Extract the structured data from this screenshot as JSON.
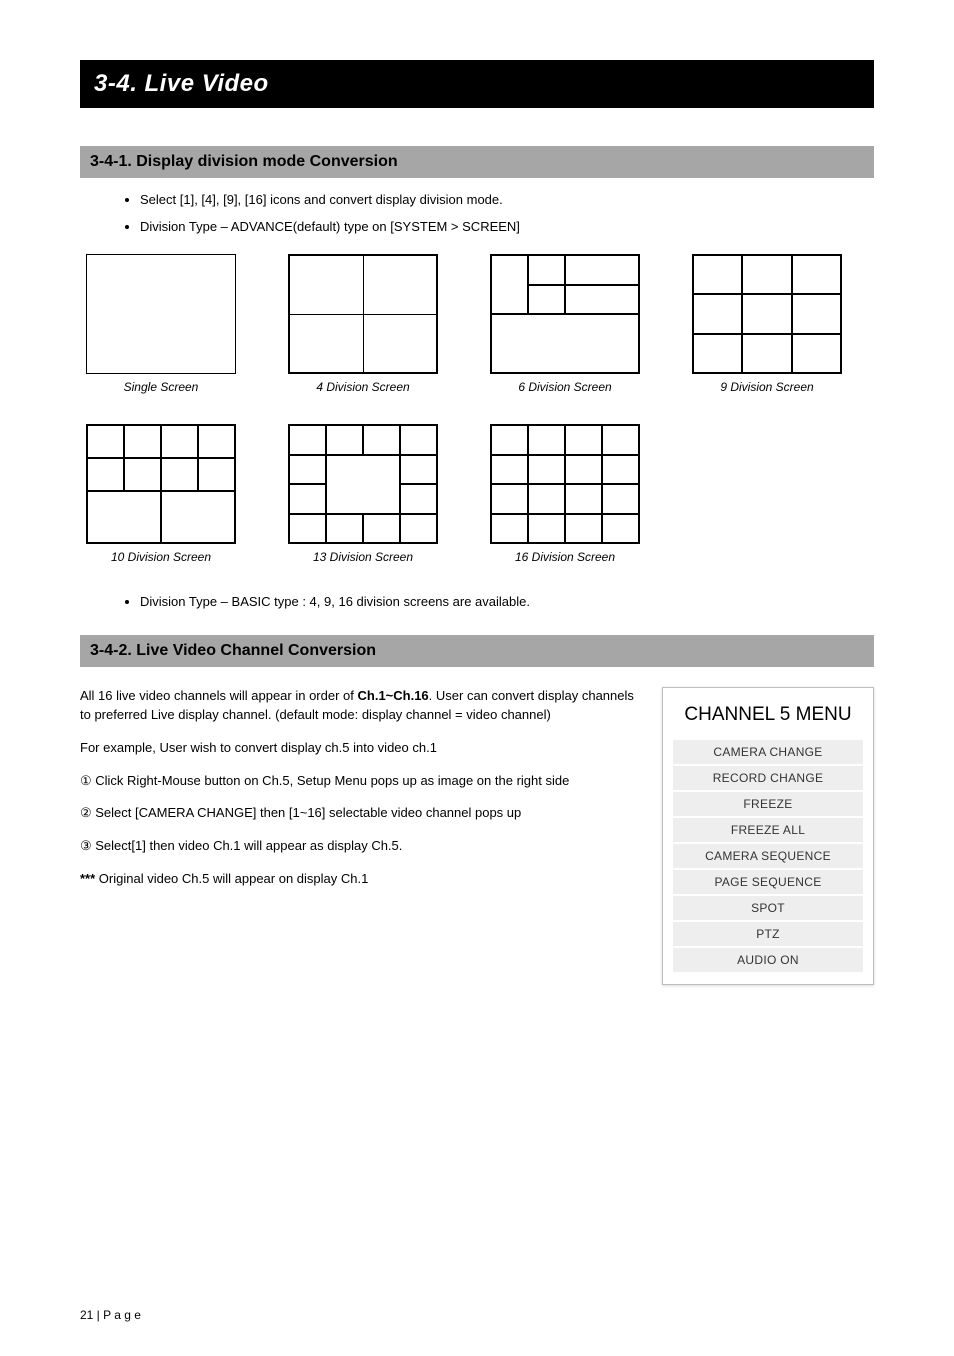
{
  "page": {
    "main_title": "3-4. Live Video",
    "section1_title": "3-4-1. Display division mode Conversion",
    "bullets_a": [
      "Select [1], [4], [9], [16] icons and convert display division mode.",
      "Division Type – ADVANCE(default) type on [SYSTEM > SCREEN]"
    ],
    "layouts_row1": [
      {
        "label": "Single Screen"
      },
      {
        "label": "4 Division Screen"
      },
      {
        "label": "6 Division Screen"
      },
      {
        "label": "9 Division Screen"
      }
    ],
    "layouts_row2": [
      {
        "label": "10 Division Screen"
      },
      {
        "label": "13 Division Screen"
      },
      {
        "label": "16 Division Screen"
      }
    ],
    "bullet_b": "Division Type – BASIC type : 4, 9, 16 division screens are available.",
    "section2_title": "3-4-2. Live Video Channel Conversion",
    "body": {
      "p1a": "All 16 live video channels will appear in order of ",
      "p1b": "Ch.1~Ch.16",
      "p1c": ". User can convert display channels to preferred Live display channel. (default mode: display channel = video channel)",
      "p2": "For example, User wish to convert display ch.5 into video ch.1",
      "steps": [
        "① Click Right-Mouse button on Ch.5, Setup Menu pops up as image on the right side",
        "② Select [CAMERA CHANGE] then [1~16] selectable video channel pops up",
        "③ Select[1] then video Ch.1 will appear as display Ch.5."
      ],
      "note_label": "*** ",
      "note": "Original video Ch.5 will appear on display Ch.1"
    },
    "menu": {
      "title": "CHANNEL 5 MENU",
      "items": [
        "CAMERA CHANGE",
        "RECORD CHANGE",
        "FREEZE",
        "FREEZE ALL",
        "CAMERA SEQUENCE",
        "PAGE SEQUENCE",
        "SPOT",
        "PTZ",
        "AUDIO ON"
      ]
    },
    "footer": "21 | P a g e"
  }
}
